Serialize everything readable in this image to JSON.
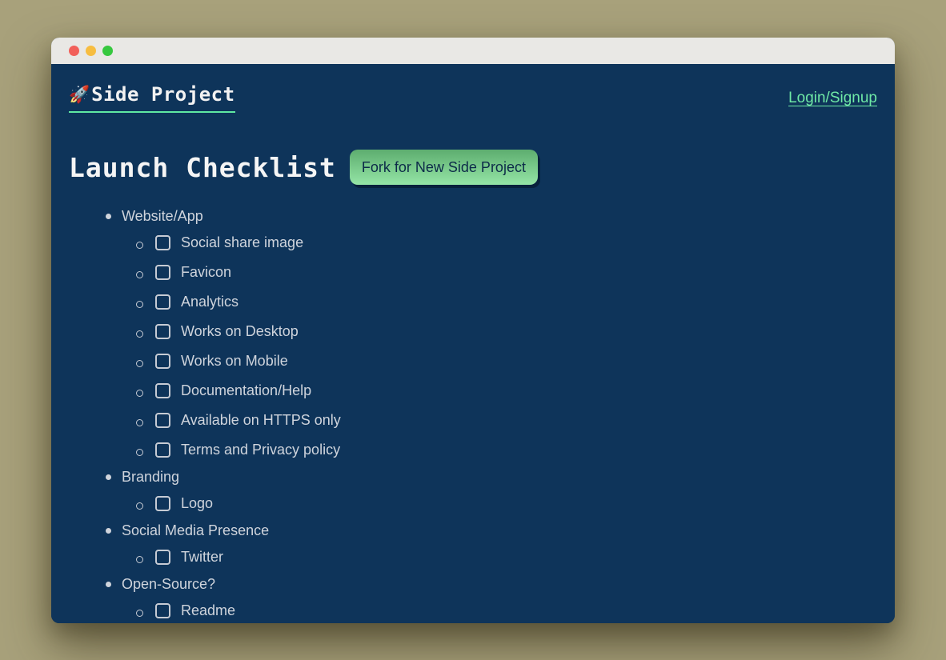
{
  "window": {
    "traffic_lights": [
      {
        "name": "close",
        "color": "#f2605a"
      },
      {
        "name": "minimize",
        "color": "#f7bd40"
      },
      {
        "name": "zoom",
        "color": "#37c83f"
      }
    ]
  },
  "header": {
    "logo_emoji": "🚀",
    "logo_text": "Side Project",
    "login_label": "Login/Signup"
  },
  "main": {
    "title": "Launch Checklist",
    "fork_button_label": "Fork for New Side Project"
  },
  "checklist": {
    "sections": [
      {
        "label": "Website/App",
        "items": [
          {
            "label": "Social share image",
            "checked": false
          },
          {
            "label": "Favicon",
            "checked": false
          },
          {
            "label": "Analytics",
            "checked": false
          },
          {
            "label": "Works on Desktop",
            "checked": false
          },
          {
            "label": "Works on Mobile",
            "checked": false
          },
          {
            "label": "Documentation/Help",
            "checked": false
          },
          {
            "label": "Available on HTTPS only",
            "checked": false
          },
          {
            "label": "Terms and Privacy policy",
            "checked": false
          }
        ]
      },
      {
        "label": "Branding",
        "items": [
          {
            "label": "Logo",
            "checked": false
          }
        ]
      },
      {
        "label": "Social Media Presence",
        "items": [
          {
            "label": "Twitter",
            "checked": false
          }
        ]
      },
      {
        "label": "Open-Source?",
        "items": [
          {
            "label": "Readme",
            "checked": false
          }
        ]
      }
    ]
  },
  "colors": {
    "desktop_background": "#a8a17b",
    "page_background": "#0e345a",
    "titlebar_background": "#e9e8e5",
    "accent_green": "#5fe8a2",
    "link_green": "#6fe9a6",
    "button_gradient_top": "#5dad6f",
    "button_gradient_bottom": "#95e5a6",
    "button_text": "#0d2b49",
    "list_text": "#cfd4dc"
  }
}
